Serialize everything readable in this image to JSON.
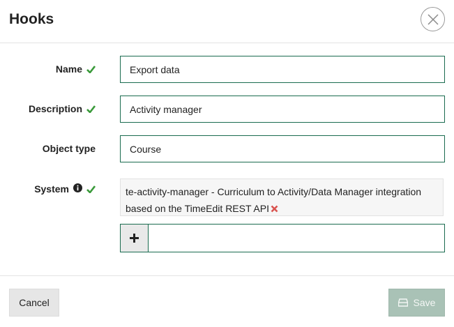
{
  "dialog": {
    "title": "Hooks",
    "close_icon": "close-icon"
  },
  "form": {
    "name": {
      "label": "Name",
      "value": "Export data",
      "status_icon": "check-icon"
    },
    "description": {
      "label": "Description",
      "value": "Activity manager",
      "status_icon": "check-icon"
    },
    "object_type": {
      "label": "Object type",
      "value": "Course"
    },
    "system": {
      "label": "System",
      "info_icon": "info-icon",
      "status_icon": "check-icon",
      "selected_line1": "te-activity-manager - Curriculum to Activity/Data Manager integration",
      "selected_line2": "based on the TimeEdit REST API",
      "remove_icon": "remove-x-icon",
      "add_icon": "plus-icon",
      "add_value": ""
    }
  },
  "footer": {
    "cancel_label": "Cancel",
    "save_label": "Save",
    "save_icon": "save-icon"
  },
  "colors": {
    "accent": "#1a6b4f",
    "check": "#3a9a3a",
    "remove": "#d9534f",
    "save_disabled": "#a9c2b6"
  }
}
